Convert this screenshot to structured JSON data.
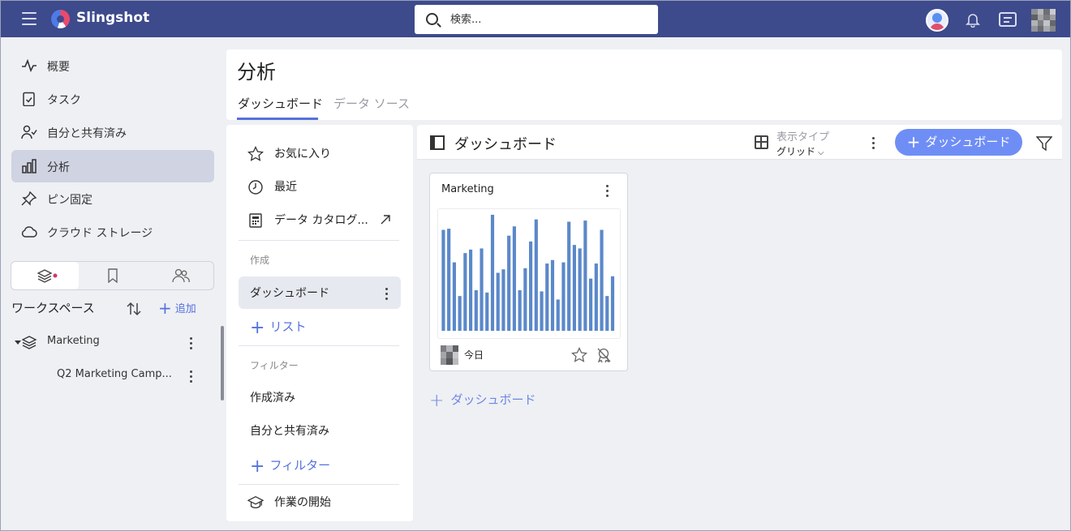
{
  "app": {
    "brand": "Slingshot"
  },
  "search": {
    "placeholder": "検索..."
  },
  "nav": {
    "items": [
      {
        "label": "概要",
        "icon": "activity-icon"
      },
      {
        "label": "タスク",
        "icon": "clipboard-check-icon"
      },
      {
        "label": "自分と共有済み",
        "icon": "user-check-icon"
      },
      {
        "label": "分析",
        "icon": "bar-chart-icon",
        "active": true
      },
      {
        "label": "ピン固定",
        "icon": "pin-icon"
      },
      {
        "label": "クラウド ストレージ",
        "icon": "cloud-icon"
      }
    ]
  },
  "workspace": {
    "title": "ワークスペース",
    "add_label": "追加",
    "tree": [
      {
        "label": "Marketing",
        "icon": "layers-icon",
        "expanded": true
      },
      {
        "label": "Q2 Marketing Camp..."
      }
    ]
  },
  "header": {
    "title": "分析",
    "tabs": [
      {
        "label": "ダッシュボード",
        "active": true
      },
      {
        "label": "データ ソース",
        "active": false
      }
    ]
  },
  "mid": {
    "favorites": "お気に入り",
    "recent": "最近",
    "catalog": "データ カタログ...",
    "create_section": "作成",
    "dashboard": "ダッシュボード",
    "list": "リスト",
    "filter_section": "フィルター",
    "created": "作成済み",
    "shared": "自分と共有済み",
    "add_filter": "フィルター",
    "get_started": "作業の開始"
  },
  "right": {
    "title": "ダッシュボード",
    "view_type_label": "表示タイプ",
    "view_type_value": "グリッド",
    "add_dashboard": "ダッシュボード",
    "add_dashboard_link": "ダッシュボード"
  },
  "card": {
    "title": "Marketing",
    "date": "今日",
    "bar_color": "#5b88c9",
    "bars": [
      0.87,
      0.88,
      0.59,
      0.3,
      0.67,
      0.7,
      0.35,
      0.71,
      0.33,
      1.0,
      0.5,
      0.53,
      0.82,
      0.9,
      0.35,
      0.54,
      0.77,
      0.96,
      0.34,
      0.58,
      0.61,
      0.27,
      0.59,
      0.94,
      0.74,
      0.71,
      0.95,
      0.45,
      0.58,
      0.87,
      0.3,
      0.47
    ]
  },
  "colors": {
    "topbar": "#3d4a8c",
    "accent": "#5571dd",
    "button": "#6f8ef5"
  }
}
